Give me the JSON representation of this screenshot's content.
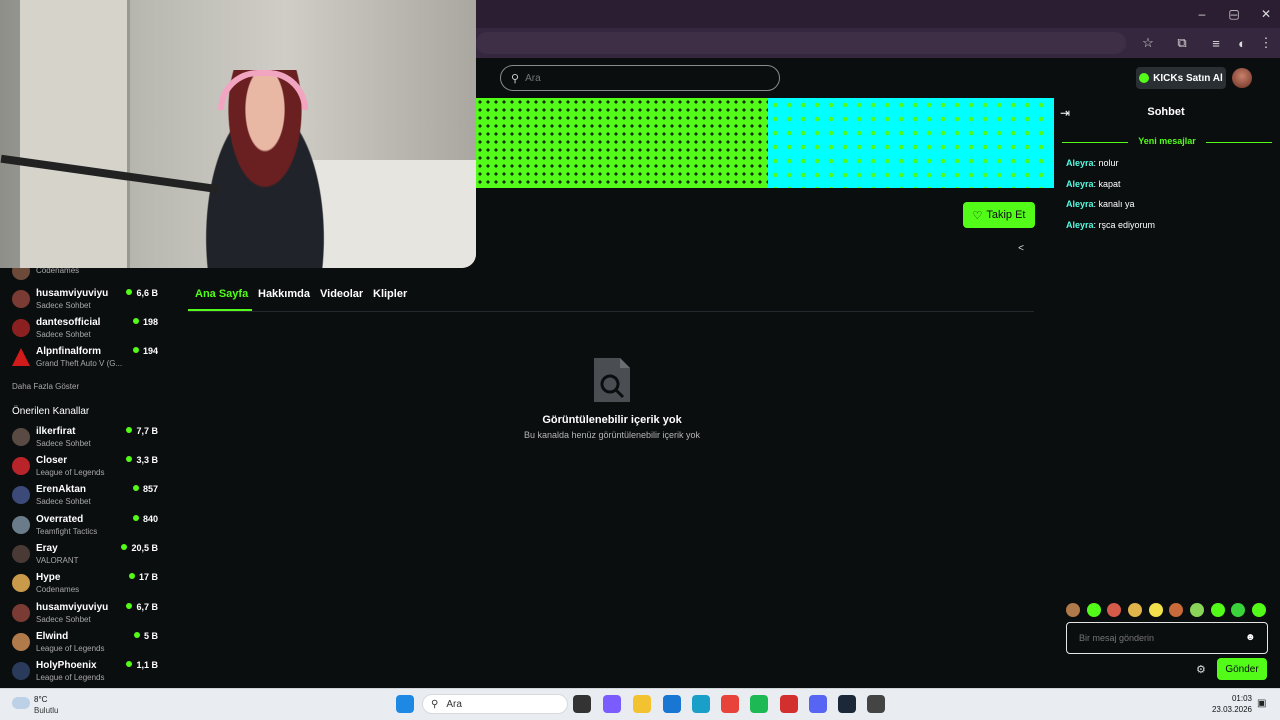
{
  "browser": {
    "window_controls": [
      "–",
      "▢",
      "✕"
    ],
    "toolbar_icons": [
      "star-icon",
      "extensions-icon",
      "media-icon",
      "profile-icon",
      "menu-icon"
    ]
  },
  "header": {
    "search_placeholder": "Ara",
    "buy_label": "KICKs Satın Al"
  },
  "channel": {
    "follow_label": "Takip Et",
    "tabs": [
      {
        "label": "Ana Sayfa",
        "active": true
      },
      {
        "label": "Hakkımda",
        "active": false
      },
      {
        "label": "Videolar",
        "active": false
      },
      {
        "label": "Klipler",
        "active": false
      }
    ],
    "empty_title": "Görüntülenebilir içerik yok",
    "empty_subtitle": "Bu kanalda henüz görüntülenebilir içerik yok"
  },
  "sidebar": {
    "followed": [
      {
        "name": "",
        "category": "Codenames",
        "viewers": ""
      },
      {
        "name": "husamviyuviyu",
        "category": "Sadece Sohbet",
        "viewers": "6,6 B"
      },
      {
        "name": "dantesofficial",
        "category": "Sadece Sohbet",
        "viewers": "198"
      },
      {
        "name": "Alpnfinalform",
        "category": "Grand Theft Auto V (G...",
        "viewers": "194"
      }
    ],
    "show_more": "Daha Fazla Göster",
    "recommended_title": "Önerilen Kanallar",
    "recommended": [
      {
        "name": "ilkerfirat",
        "category": "Sadece Sohbet",
        "viewers": "7,7 B"
      },
      {
        "name": "Closer",
        "category": "League of Legends",
        "viewers": "3,3 B"
      },
      {
        "name": "ErenAktan",
        "category": "Sadece Sohbet",
        "viewers": "857"
      },
      {
        "name": "Overrated",
        "category": "Teamfight Tactics",
        "viewers": "840"
      },
      {
        "name": "Eray",
        "category": "VALORANT",
        "viewers": "20,5 B"
      },
      {
        "name": "Hype",
        "category": "Codenames",
        "viewers": "17 B"
      },
      {
        "name": "husamviyuviyu",
        "category": "Sadece Sohbet",
        "viewers": "6,7 B"
      },
      {
        "name": "Elwind",
        "category": "League of Legends",
        "viewers": "5 B"
      },
      {
        "name": "HolyPhoenix",
        "category": "League of Legends",
        "viewers": "1,1 B"
      }
    ]
  },
  "chat": {
    "title": "Sohbet",
    "new_messages": "Yeni mesajlar",
    "messages": [
      {
        "user": "Aleyra",
        "text": ": nolur"
      },
      {
        "user": "Aleyra",
        "text": ": kapat"
      },
      {
        "user": "Aleyra",
        "text": ": kanalı ya"
      },
      {
        "user": "Aleyra",
        "text": ": rşca ediyorum"
      }
    ],
    "input_placeholder": "Bir mesaj gönderin",
    "send_label": "Gönder"
  },
  "taskbar": {
    "weather_temp": "8°C",
    "weather_desc": "Bulutlu",
    "search_label": "Ara",
    "time": "01:03",
    "date": "23.03.2026"
  },
  "colors": {
    "accent": "#53fc18",
    "background": "#0b0e0f",
    "chat_user": "#53fce0"
  }
}
